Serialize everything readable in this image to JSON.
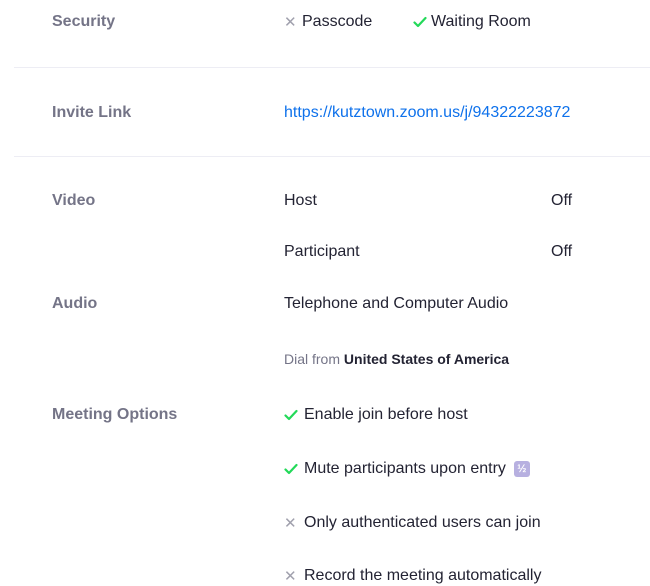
{
  "security": {
    "label": "Security",
    "passcode": {
      "label": "Passcode",
      "enabled": false
    },
    "waiting_room": {
      "label": "Waiting Room",
      "enabled": true
    }
  },
  "invite": {
    "label": "Invite Link",
    "url": "https://kutztown.zoom.us/j/94322223872"
  },
  "video": {
    "label": "Video",
    "host_label": "Host",
    "host_value": "Off",
    "participant_label": "Participant",
    "participant_value": "Off"
  },
  "audio": {
    "label": "Audio",
    "value": "Telephone and Computer Audio",
    "dial_prefix": "Dial from",
    "dial_country": "United States of America"
  },
  "meeting_options": {
    "label": "Meeting Options",
    "options": [
      {
        "label": "Enable join before host",
        "enabled": true
      },
      {
        "label": "Mute participants upon entry",
        "enabled": true,
        "info_badge": "½"
      },
      {
        "label": "Only authenticated users can join",
        "enabled": false
      },
      {
        "label": "Record the meeting automatically",
        "enabled": false
      }
    ]
  },
  "colors": {
    "label_gray": "#747487",
    "link_blue": "#0e71eb",
    "check_green": "#23d959",
    "x_gray": "#a0a0ad",
    "divider": "#ededf4"
  }
}
